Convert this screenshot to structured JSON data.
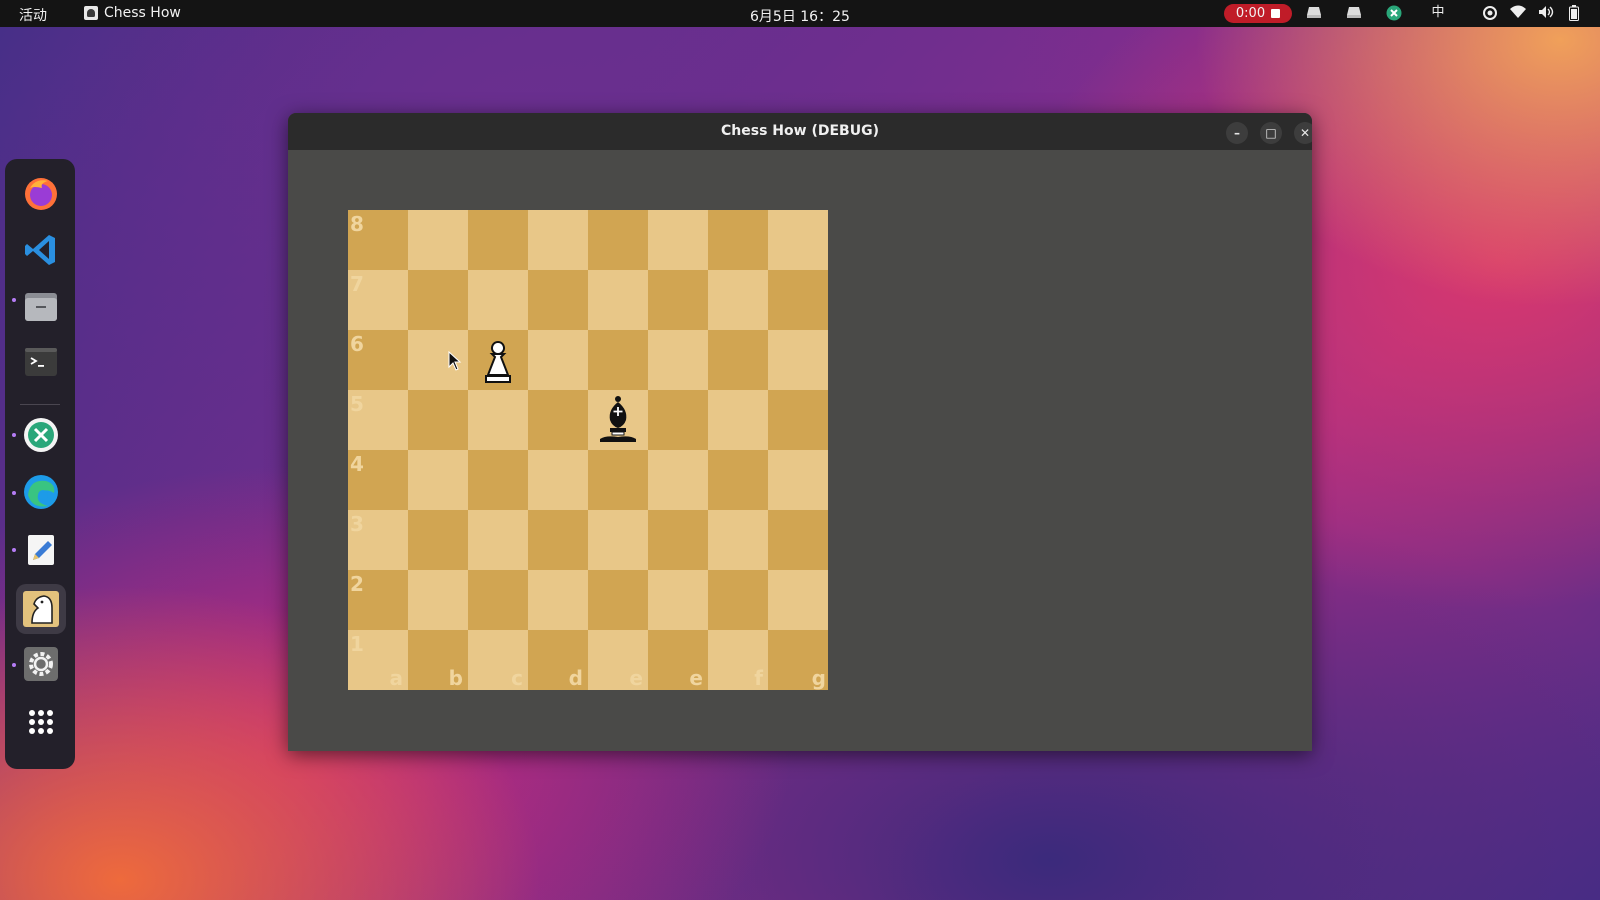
{
  "topbar": {
    "activities": "活动",
    "app_name": "Chess How",
    "clock": "6月5日 16：25",
    "record_time": "0:00",
    "input_method": "中"
  },
  "dock": {
    "items": [
      {
        "name": "firefox-icon",
        "running": false
      },
      {
        "name": "vscode-icon",
        "running": false
      },
      {
        "name": "files-icon",
        "running": true
      },
      {
        "name": "terminal-icon",
        "running": false
      },
      {
        "name": "remote-desktop-icon",
        "running": true
      },
      {
        "name": "edge-icon",
        "running": true
      },
      {
        "name": "text-editor-icon",
        "running": true
      },
      {
        "name": "chess-knight-icon",
        "running": true
      },
      {
        "name": "settings-icon",
        "running": true
      },
      {
        "name": "app-grid-icon",
        "running": false
      }
    ]
  },
  "window": {
    "title": "Chess How (DEBUG)",
    "minimize": "–",
    "maximize": "□",
    "close": "✕"
  },
  "board": {
    "ranks": [
      "8",
      "7",
      "6",
      "5",
      "4",
      "3",
      "2",
      "1"
    ],
    "files": [
      "a",
      "b",
      "c",
      "d",
      "e",
      "e",
      "f",
      "g"
    ],
    "pieces": [
      {
        "square": "c6",
        "type": "pawn",
        "color": "white"
      },
      {
        "square": "e5",
        "type": "bishop",
        "color": "black"
      }
    ],
    "colors": {
      "light": "#e8c788",
      "dark": "#d1a552"
    }
  }
}
